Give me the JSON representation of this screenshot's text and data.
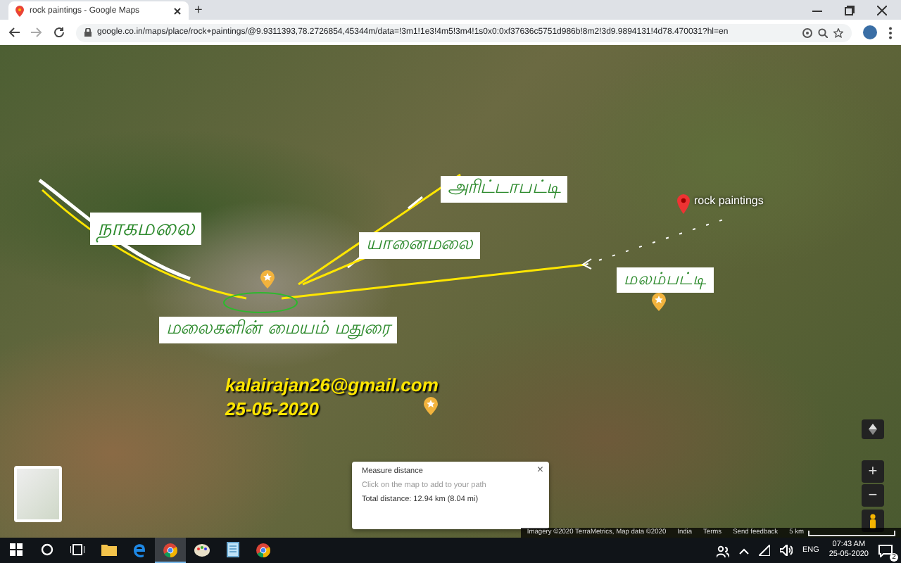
{
  "browser": {
    "tab": {
      "title": "rock paintings - Google Maps",
      "selected": true
    },
    "new_tab": "+",
    "url": "google.co.in/maps/place/rock+paintings/@9.9311393,78.2726854,45344m/data=!3m1!1e3!4m5!3m4!1s0x0:0xf37636c5751d986b!8m2!3d9.9894131!4d78.470031?hl=en"
  },
  "map": {
    "annotations": [
      {
        "kind": "label",
        "text": "நாகமலை"
      },
      {
        "kind": "label",
        "text": "அரிட்டாபட்டி"
      },
      {
        "kind": "label",
        "text": "யானைமலை"
      },
      {
        "kind": "label",
        "text": "மலம்பட்டி"
      },
      {
        "kind": "label",
        "text": "மலைகளின் மையம் மதுரை"
      },
      {
        "kind": "caption",
        "text": "kalairajan26@gmail.com"
      },
      {
        "kind": "caption",
        "text": "25-05-2020"
      }
    ],
    "place_pin": {
      "label": "rock paintings"
    },
    "measure": {
      "title": "Measure distance",
      "hint": "Click on the map to add to your path",
      "total": "Total distance: 12.94 km (8.04 mi)",
      "close": "×"
    },
    "zoom": {
      "in": "+",
      "out": "−"
    },
    "attribution": [
      "Imagery ©2020 TerraMetrics, Map data ©2020",
      "India",
      "Terms",
      "Send feedback"
    ],
    "scale": "5 km"
  },
  "taskbar": {
    "apps": [
      {
        "kind": "search",
        "selected": false
      },
      {
        "kind": "taskview",
        "selected": false
      },
      {
        "kind": "folder",
        "selected": false
      },
      {
        "kind": "edge",
        "selected": false
      },
      {
        "kind": "chrome",
        "selected": true
      },
      {
        "kind": "paint",
        "selected": false
      },
      {
        "kind": "notes",
        "selected": false
      },
      {
        "kind": "chrome",
        "selected": false
      }
    ],
    "language": "ENG",
    "time": "07:43 AM",
    "date": "25-05-2020",
    "notifications": "2"
  }
}
